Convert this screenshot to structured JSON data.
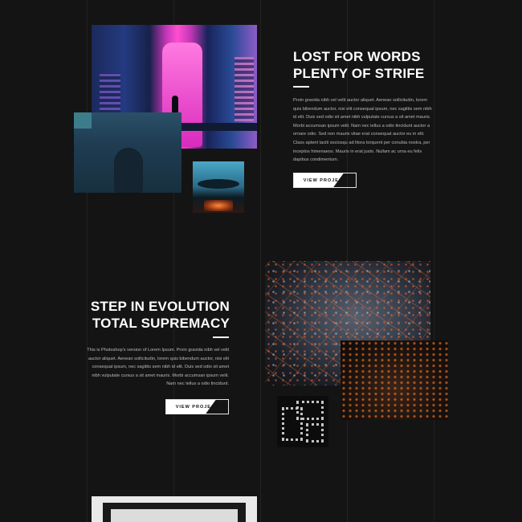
{
  "sections": [
    {
      "heading_line1": "LOST FOR WORDS",
      "heading_line2": "PLENTY OF STRIFE",
      "paragraph": "Proin gravida nibh vel velit auctor aliquet. Aenean sollicitudin, lorem quis bibendum auctor, nisi elit consequat ipsum, nec sagittis sem nibh id elit. Duis sed odio sit amet nibh vulputate cursus a sit amet mauris. Morbi accumsan ipsum velit. Nam nec tellus a odio tincidunt auctor a ornare odio. Sed non mauris vitae erat consequat auctor eu in elit. Class aptent taciti sociosqu ad litora torquent per conubia nostra, per inceptos himenaeos. Mauris in erat justo. Nullam ac urna eu felis dapibus condimentum.",
      "button_label": "VIEW PROJECT"
    },
    {
      "heading_line1": "STEP IN EVOLUTION",
      "heading_line2": "TOTAL SUPREMACY",
      "paragraph": "This is Photoshop's version of Lorem Ipsum. Proin gravida nibh vel velit auctor aliquet. Aenean sollicitudin, lorem quis bibendum auctor, nisi elit consequat ipsum, nec sagittis sem nibh id elit. Duis sed odio sit amet nibh vulputate cursus a sit amet mauris. Morbi accumsan ipsum velit. Nam nec tellus a odio tincidunt.",
      "button_label": "VIEW PROJECT"
    }
  ],
  "colors": {
    "background": "#141414",
    "heading": "#ffffff",
    "body_text": "#b9b9b9"
  }
}
